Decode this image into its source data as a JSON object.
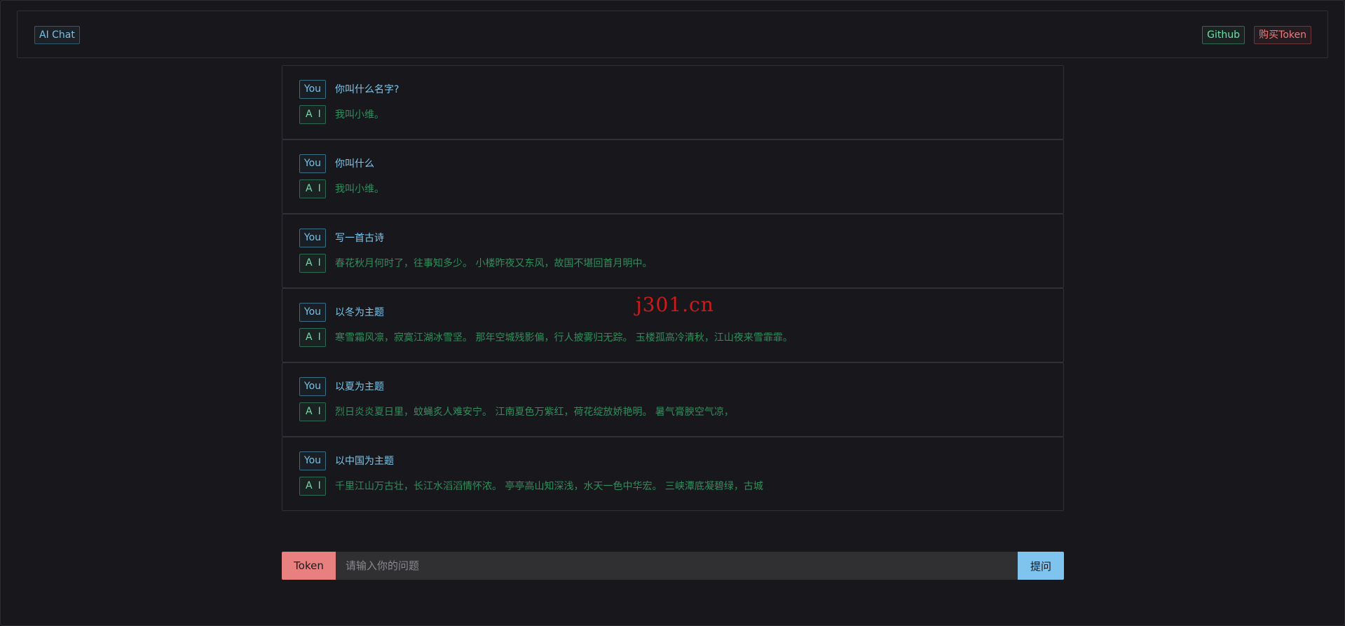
{
  "header": {
    "brand": "AI Chat",
    "github_label": "Github",
    "buy_token_label": "购买Token"
  },
  "chat": {
    "you_label": "You",
    "ai_label": "AI",
    "messages": [
      {
        "question": "你叫什么名字?",
        "answer": "我叫小维。"
      },
      {
        "question": "你叫什么",
        "answer": "我叫小维。"
      },
      {
        "question": "写一首古诗",
        "answer": "春花秋月何时了，往事知多少。 小楼昨夜又东风，故国不堪回首月明中。"
      },
      {
        "question": "以冬为主题",
        "answer": "寒雪霜风凛，寂寞江湖冰雪坚。 那年空城残影偏，行人披雾归无踪。 玉楼孤高冷清秋，江山夜来雪霏霏。"
      },
      {
        "question": "以夏为主题",
        "answer": "烈日炎炎夏日里，蚊蝇炙人难安宁。 江南夏色万紫红，荷花绽放娇艳明。 暑气膏腴空气凉，"
      },
      {
        "question": "以中国为主题",
        "answer": "千里江山万古壮，长江水滔滔情怀浓。 亭亭高山知深浅，水天一色中华宏。 三峡潭底凝碧绿，古城"
      }
    ]
  },
  "watermark": "j301.cn",
  "input_bar": {
    "token_label": "Token",
    "placeholder": "请输入你的问题",
    "submit_label": "提问"
  }
}
